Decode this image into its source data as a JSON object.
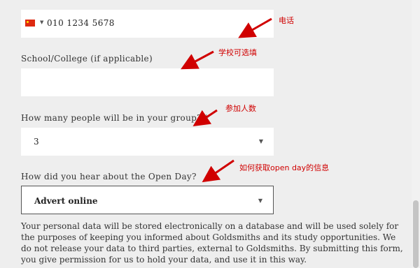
{
  "phone": {
    "flag": "china-flag-icon",
    "value": "010 1234 5678"
  },
  "school": {
    "label": "School/College (if applicable)",
    "value": ""
  },
  "group": {
    "label": "How many people will be in your group? *",
    "value": "3"
  },
  "hear": {
    "label": "How did you hear about the Open Day?",
    "value": "Advert online"
  },
  "notice": "Your personal data will be stored electronically on a database and will be used solely for the purposes of keeping you informed about Goldsmiths and its study opportunities. We do not release your data to third parties, external to Goldsmiths. By submitting this form, you give permission for us to hold your data, and use it in this way.",
  "annotations": {
    "phone": "电话",
    "school": "学校可选填",
    "group": "参加人数",
    "hear": "如何获取open day的信息"
  },
  "colors": {
    "annotation": "#d00000",
    "field": "#ffffff",
    "background": "#eeeeee"
  }
}
